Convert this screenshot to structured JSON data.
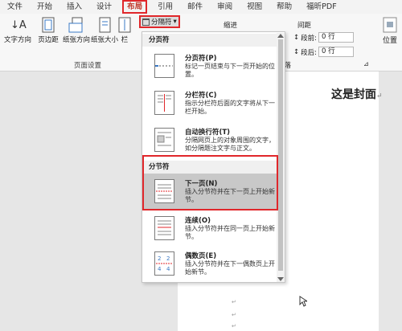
{
  "menu": [
    "文件",
    "开始",
    "插入",
    "设计",
    "布局",
    "引用",
    "邮件",
    "审阅",
    "视图",
    "帮助",
    "福昕PDF"
  ],
  "ribbon": {
    "text_direction": "文字方向",
    "margins": "页边距",
    "orientation": "纸张方向",
    "size": "纸张大小",
    "columns": "栏",
    "breaks": "分隔符",
    "page_setup": "页面设置",
    "indent": "缩进",
    "spacing": "间距",
    "before_label": "段前:",
    "before_value": "0 行",
    "after_label": "段后:",
    "after_value": "0 行",
    "paragraph": "段落",
    "position": "位置"
  },
  "dropdown": {
    "page_breaks_header": "分页符",
    "section_breaks_header": "分节符",
    "items": [
      {
        "title": "分页符(P)",
        "desc": "标记一页结束与下一页开始的位置。"
      },
      {
        "title": "分栏符(C)",
        "desc": "指示分栏符后面的文字将从下一栏开始。"
      },
      {
        "title": "自动换行符(T)",
        "desc": "分隔网页上的对象周围的文字，如分隔题注文字与正文。"
      },
      {
        "title": "下一页(N)",
        "desc": "插入分节符并在下一页上开始新节。"
      },
      {
        "title": "连续(O)",
        "desc": "插入分节符并在同一页上开始新节。"
      },
      {
        "title": "偶数页(E)",
        "desc": "插入分节符并在下一偶数页上开始新节。"
      }
    ]
  },
  "document": {
    "title": "这是封面",
    "return_mark": "↵"
  }
}
